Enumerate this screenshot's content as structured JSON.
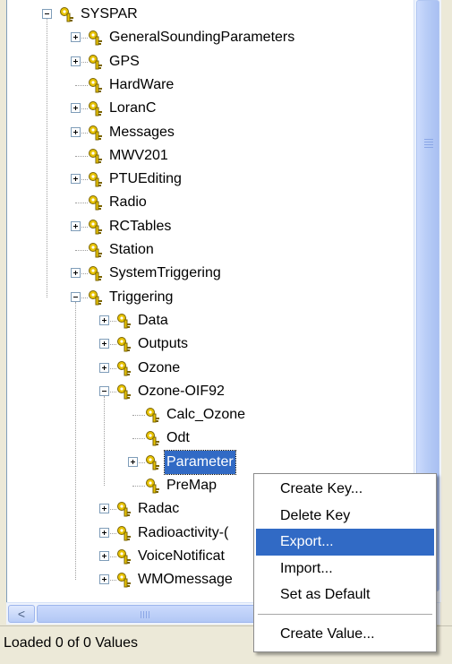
{
  "tree": {
    "nodes": [
      {
        "label": "SYSPAR",
        "expander": "minus",
        "depth": 0,
        "selected": false
      },
      {
        "label": "GeneralSoundingParameters",
        "expander": "plus",
        "depth": 1,
        "selected": false
      },
      {
        "label": "GPS",
        "expander": "plus",
        "depth": 1,
        "selected": false
      },
      {
        "label": "HardWare",
        "expander": "none",
        "depth": 1,
        "selected": false
      },
      {
        "label": "LoranC",
        "expander": "plus",
        "depth": 1,
        "selected": false
      },
      {
        "label": "Messages",
        "expander": "plus",
        "depth": 1,
        "selected": false
      },
      {
        "label": "MWV201",
        "expander": "none",
        "depth": 1,
        "selected": false
      },
      {
        "label": "PTUEditing",
        "expander": "plus",
        "depth": 1,
        "selected": false
      },
      {
        "label": "Radio",
        "expander": "none",
        "depth": 1,
        "selected": false
      },
      {
        "label": "RCTables",
        "expander": "plus",
        "depth": 1,
        "selected": false
      },
      {
        "label": "Station",
        "expander": "none",
        "depth": 1,
        "selected": false
      },
      {
        "label": "SystemTriggering",
        "expander": "plus",
        "depth": 1,
        "selected": false
      },
      {
        "label": "Triggering",
        "expander": "minus",
        "depth": 1,
        "selected": false
      },
      {
        "label": "Data",
        "expander": "plus",
        "depth": 2,
        "selected": false
      },
      {
        "label": "Outputs",
        "expander": "plus",
        "depth": 2,
        "selected": false
      },
      {
        "label": "Ozone",
        "expander": "plus",
        "depth": 2,
        "selected": false
      },
      {
        "label": "Ozone-OIF92",
        "expander": "minus",
        "depth": 2,
        "selected": false
      },
      {
        "label": "Calc_Ozone",
        "expander": "none",
        "depth": 3,
        "selected": false
      },
      {
        "label": "Odt",
        "expander": "none",
        "depth": 3,
        "selected": false
      },
      {
        "label": "Parameter",
        "expander": "plus",
        "depth": 3,
        "selected": true
      },
      {
        "label": "PreMap",
        "expander": "none",
        "depth": 3,
        "selected": false
      },
      {
        "label": "Radac",
        "expander": "plus",
        "depth": 2,
        "selected": false
      },
      {
        "label": "Radioactivity-(",
        "expander": "plus",
        "depth": 2,
        "selected": false
      },
      {
        "label": "VoiceNotificat",
        "expander": "plus",
        "depth": 2,
        "selected": false
      },
      {
        "label": "WMOmessage",
        "expander": "plus",
        "depth": 2,
        "selected": false
      }
    ]
  },
  "scrollbars": {
    "left_arrow": "<",
    "colors": {
      "thumb": "#b6cbf6",
      "track": "#eef3fc"
    }
  },
  "status_bar": {
    "text": "Loaded 0 of 0 Values"
  },
  "context_menu": {
    "items": [
      {
        "label": "Create Key...",
        "highlighted": false
      },
      {
        "label": "Delete Key",
        "highlighted": false
      },
      {
        "label": "Export...",
        "highlighted": true
      },
      {
        "label": "Import...",
        "highlighted": false
      },
      {
        "label": "Set as Default",
        "highlighted": false
      },
      {
        "separator": true
      },
      {
        "label": "Create Value...",
        "highlighted": false
      }
    ]
  },
  "colors": {
    "selection": "#316ac5",
    "key_icon": "#e8c300",
    "background": "#ece9d8"
  },
  "icons": {
    "tree_node": "registry-key-icon",
    "expand": "plus-box-icon",
    "collapse": "minus-box-icon"
  }
}
